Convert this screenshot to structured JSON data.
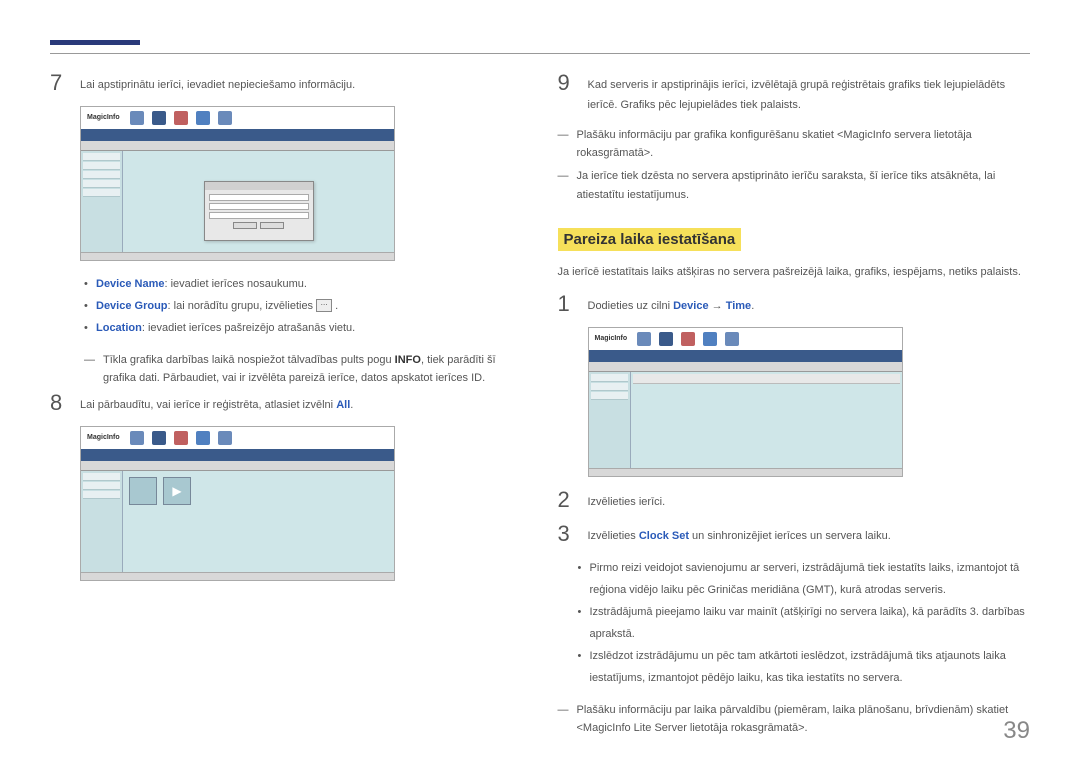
{
  "page_number": "39",
  "left_col": {
    "step7": {
      "num": "7",
      "text": "Lai apstiprinātu ierīci, ievadiet nepieciešamo informāciju."
    },
    "bullets": {
      "device_name_label": "Device Name",
      "device_name_text": ": ievadiet ierīces nosaukumu.",
      "device_group_label": "Device Group",
      "device_group_text": ": lai norādītu grupu, izvēlieties ",
      "location_label": "Location",
      "location_text": ": ievadiet ierīces pašreizējo atrašanās vietu."
    },
    "dash_note_prefix": "Tīkla grafika darbības laikā nospiežot tālvadības pults pogu ",
    "dash_note_info": "INFO",
    "dash_note_suffix": ", tiek parādīti šī grafika dati. Pārbaudiet, vai ir izvēlēta pareizā ierīce, datos apskatot ierīces ID.",
    "step8": {
      "num": "8",
      "text_prefix": "Lai pārbaudītu, vai ierīce ir reģistrēta, atlasiet izvēlni ",
      "all_label": "All",
      "text_suffix": "."
    }
  },
  "right_col": {
    "step9": {
      "num": "9",
      "text": "Kad serveris ir apstiprinājis ierīci, izvēlētajā grupā reģistrētais grafiks tiek lejupielādēts ierīcē. Grafiks pēc lejupielādes tiek palaists."
    },
    "dash1": "Plašāku informāciju par grafika konfigurēšanu skatiet <MagicInfo servera lietotāja rokasgrāmatā>.",
    "dash2": "Ja ierīce tiek dzēsta no servera apstiprināto ierīču saraksta, šī ierīce tiks atsāknēta, lai atiestatītu iestatījumus.",
    "heading": "Pareiza laika iestatīšana",
    "heading_desc": "Ja ierīcē iestatītais laiks atšķiras no servera pašreizējā laika, grafiks, iespējams, netiks palaists.",
    "step1": {
      "num": "1",
      "text_prefix": "Dodieties uz cilni ",
      "device_label": "Device",
      "arrow": " → ",
      "time_label": "Time",
      "text_suffix": "."
    },
    "step2": {
      "num": "2",
      "text": "Izvēlieties ierīci."
    },
    "step3": {
      "num": "3",
      "text_prefix": "Izvēlieties ",
      "clock_set_label": "Clock Set",
      "text_suffix": " un sinhronizējiet ierīces un servera laiku."
    },
    "bullets": {
      "b1": "Pirmo reizi veidojot savienojumu ar serveri, izstrādājumā tiek iestatīts laiks, izmantojot tā reģiona vidējo laiku pēc Griničas meridiāna (GMT), kurā atrodas serveris.",
      "b2": "Izstrādājumā pieejamo laiku var mainīt (atšķirīgi no servera laika), kā parādīts 3. darbības aprakstā.",
      "b3": "Izslēdzot izstrādājumu un pēc tam atkārtoti ieslēdzot, izstrādājumā tiks atjaunots laika iestatījums, izmantojot pēdējo laiku, kas tika iestatīts no servera."
    },
    "dash3": "Plašāku informāciju par laika pārvaldību (piemēram, laika plānošanu, brīvdienām) skatiet <MagicInfo Lite Server lietotāja rokasgrāmatā>.",
    "logo": "MagicInfo"
  }
}
